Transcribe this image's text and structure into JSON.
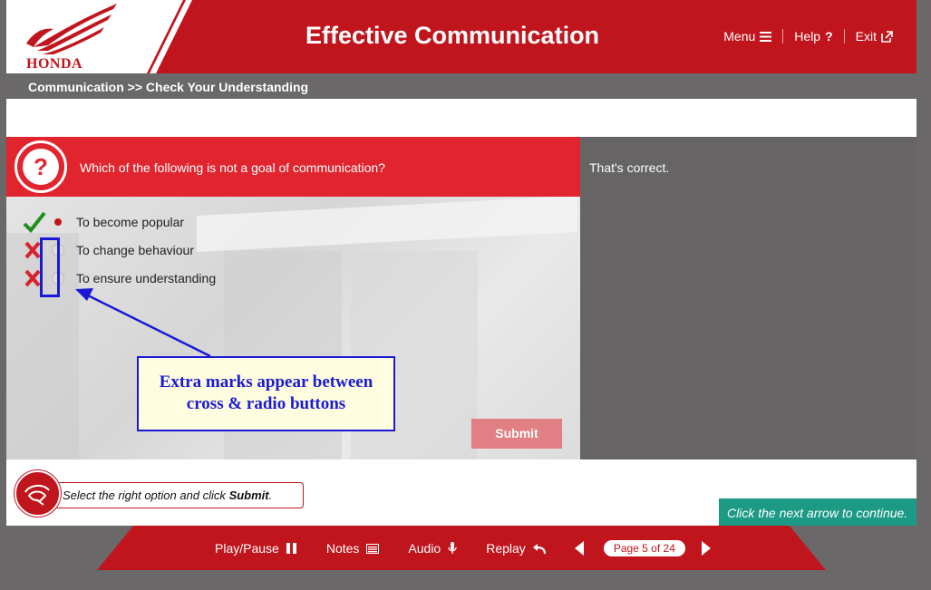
{
  "header": {
    "logo_text": "HONDA",
    "title": "Effective Communication",
    "nav": [
      {
        "label": "Menu",
        "icon": "hamburger-icon"
      },
      {
        "label": "Help",
        "icon": "question-icon"
      },
      {
        "label": "Exit",
        "icon": "external-link-icon"
      }
    ]
  },
  "breadcrumb": "Communication >> Check Your Understanding",
  "question": {
    "icon": "question-bubble-icon",
    "text": "Which of the following is not a goal of communication?"
  },
  "options": [
    {
      "label": "To become popular",
      "selected": true,
      "mark": "correct"
    },
    {
      "label": "To change behaviour",
      "selected": false,
      "mark": "incorrect"
    },
    {
      "label": "To ensure understanding",
      "selected": false,
      "mark": "incorrect"
    }
  ],
  "callout": {
    "line1": "Extra marks appear between",
    "line2": "cross & radio buttons"
  },
  "submit_label": "Submit",
  "feedback": "That's correct.",
  "instruction": {
    "prefix": "Select the right option and click ",
    "bold": "Submit",
    "suffix": "."
  },
  "continue_text": "Click the next arrow to continue.",
  "footer": {
    "play_pause": "Play/Pause",
    "notes": "Notes",
    "audio": "Audio",
    "replay": "Replay",
    "page_indicator": "Page 5 of 24"
  },
  "colors": {
    "brand_red": "#c1151e",
    "question_red": "#e0252f",
    "gray": "#6a6869",
    "teal": "#1d9a86",
    "annotation_blue": "#1a1ad6"
  }
}
